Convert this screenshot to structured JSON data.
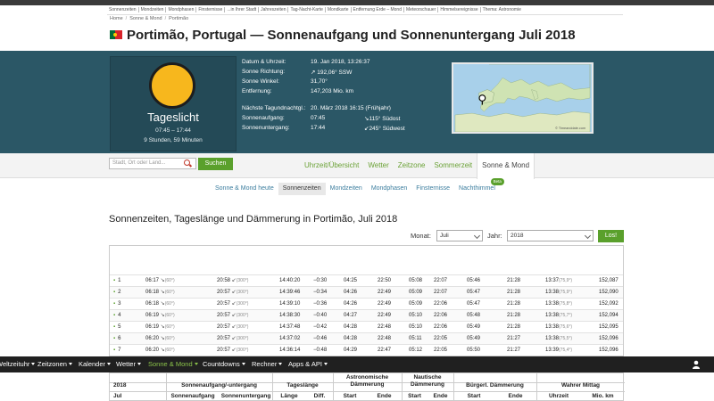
{
  "top_links": [
    "Sonnenzeiten",
    "Mondzeiten",
    "Mondphasen",
    "Finsternisse",
    "...in Ihrer Stadt",
    "Jahreszeiten",
    "Tag-Nacht-Karte",
    "Mondkarte",
    "Entfernung Erde – Mond",
    "Meteorschauer",
    "Himmelsereignisse",
    "Thema: Astronomie"
  ],
  "breadcrumb": {
    "home": "Home",
    "section": "Sonne & Mond",
    "page": "Portimão"
  },
  "title": "Portimão, Portugal — Sonnenaufgang und Sonnenuntergang Juli 2018",
  "daylight": {
    "title": "Tageslicht",
    "times": "07:45 – 17:44",
    "hours": "9 Stunden, 59 Minuten"
  },
  "info": {
    "datetime_label": "Datum & Uhrzeit:",
    "datetime": "19. Jan 2018, 13:26:37",
    "direction_label": "Sonne Richtung:",
    "direction": "↗ 192,06° SSW",
    "angle_label": "Sonne Winkel:",
    "angle": "31,70°",
    "distance_label": "Entfernung:",
    "distance": "147,203 Mio. km",
    "equinox_label": "Nächste Tagundnachtgl.:",
    "equinox": "20. März 2018 16:15 (Frühjahr)",
    "sunrise_label": "Sonnenaufgang:",
    "sunrise": "07:45",
    "sunrise_dir": "↘115° Südost",
    "sunset_label": "Sonnenuntergang:",
    "sunset": "17:44",
    "sunset_dir": "↙245° Südwest"
  },
  "map_credit": "© Timeanddate.com",
  "search": {
    "placeholder": "Stadt, Ort oder Land...",
    "button": "Suchen"
  },
  "tabs": [
    "Uhrzeit/Übersicht",
    "Wetter",
    "Zeitzone",
    "Sommerzeit",
    "Sonne & Mond"
  ],
  "subnav": [
    "Sonne & Mond heute",
    "Sonnenzeiten",
    "Mondzeiten",
    "Mondphasen",
    "Finsternisse",
    "Nachthimmel"
  ],
  "subnav_badge": "Beta",
  "heading": "Sonnenzeiten, Tageslänge und Dämmerung in Portimão, Juli 2018",
  "controls": {
    "month_label": "Monat:",
    "month": "Juli",
    "year_label": "Jahr:",
    "year": "2018",
    "go": "Los!"
  },
  "rows": [
    {
      "day": "1",
      "rise": "06:17",
      "rise_deg": "(60°)",
      "set": "20:58",
      "set_deg": "(300°)",
      "len": "14:40:20",
      "diff": "−0:30",
      "a1": "04:25",
      "a2": "22:50",
      "n1": "05:08",
      "n2": "22:07",
      "b1": "05:46",
      "b2": "21:28",
      "noon": "13:37",
      "noon_deg": "(75,9°)",
      "dist": "152,087"
    },
    {
      "day": "2",
      "rise": "06:18",
      "rise_deg": "(60°)",
      "set": "20:57",
      "set_deg": "(300°)",
      "len": "14:39:46",
      "diff": "−0:34",
      "a1": "04:26",
      "a2": "22:49",
      "n1": "05:09",
      "n2": "22:07",
      "b1": "05:47",
      "b2": "21:28",
      "noon": "13:38",
      "noon_deg": "(75,9°)",
      "dist": "152,090"
    },
    {
      "day": "3",
      "rise": "06:18",
      "rise_deg": "(60°)",
      "set": "20:57",
      "set_deg": "(300°)",
      "len": "14:39:10",
      "diff": "−0:36",
      "a1": "04:26",
      "a2": "22:49",
      "n1": "05:09",
      "n2": "22:06",
      "b1": "05:47",
      "b2": "21:28",
      "noon": "13:38",
      "noon_deg": "(75,8°)",
      "dist": "152,092"
    },
    {
      "day": "4",
      "rise": "06:19",
      "rise_deg": "(60°)",
      "set": "20:57",
      "set_deg": "(300°)",
      "len": "14:38:30",
      "diff": "−0:40",
      "a1": "04:27",
      "a2": "22:49",
      "n1": "05:10",
      "n2": "22:06",
      "b1": "05:48",
      "b2": "21:28",
      "noon": "13:38",
      "noon_deg": "(75,7°)",
      "dist": "152,094"
    },
    {
      "day": "5",
      "rise": "06:19",
      "rise_deg": "(60°)",
      "set": "20:57",
      "set_deg": "(300°)",
      "len": "14:37:48",
      "diff": "−0:42",
      "a1": "04:28",
      "a2": "22:48",
      "n1": "05:10",
      "n2": "22:06",
      "b1": "05:49",
      "b2": "21:28",
      "noon": "13:38",
      "noon_deg": "(75,6°)",
      "dist": "152,095"
    },
    {
      "day": "6",
      "rise": "06:20",
      "rise_deg": "(60°)",
      "set": "20:57",
      "set_deg": "(300°)",
      "len": "14:37:02",
      "diff": "−0:46",
      "a1": "04:28",
      "a2": "22:48",
      "n1": "05:11",
      "n2": "22:05",
      "b1": "05:49",
      "b2": "21:27",
      "noon": "13:38",
      "noon_deg": "(75,5°)",
      "dist": "152,096"
    },
    {
      "day": "7",
      "rise": "06:20",
      "rise_deg": "(60°)",
      "set": "20:57",
      "set_deg": "(300°)",
      "len": "14:36:14",
      "diff": "−0:48",
      "a1": "04:29",
      "a2": "22:47",
      "n1": "05:12",
      "n2": "22:05",
      "b1": "05:50",
      "b2": "21:27",
      "noon": "13:39",
      "noon_deg": "(75,4°)",
      "dist": "152,096"
    }
  ],
  "bottom_nav": [
    {
      "label": "Weltzeituhr",
      "caret": true
    },
    {
      "label": "Zeitzonen",
      "caret": true
    },
    {
      "label": "Kalender",
      "caret": true
    },
    {
      "label": "Wetter",
      "caret": true
    },
    {
      "label": "Sonne & Mond",
      "caret": true,
      "active": true
    },
    {
      "label": "Countdowns",
      "caret": true
    },
    {
      "label": "Rechner",
      "caret": true
    },
    {
      "label": "Apps & API",
      "caret": true
    }
  ],
  "table_header": {
    "year": "2018",
    "month": "Jul",
    "g_sun": "Sonnenaufgang/-untergang",
    "g_len": "Tageslänge",
    "g_astro": "Astronomische Dämmerung",
    "g_naut": "Nautische Dämmerung",
    "g_civil": "Bürgerl. Dämmerung",
    "g_noon": "Wahrer Mittag",
    "c_rise": "Sonnenaufgang",
    "c_set": "Sonnenuntergang",
    "c_len": "Länge",
    "c_diff": "Diff.",
    "c_start": "Start",
    "c_end": "Ende",
    "c_time": "Uhrzeit",
    "c_dist": "Mio. km"
  },
  "colors": {
    "hero": "#2b5766",
    "accent": "#5aa02c",
    "sun": "#f7b71d"
  }
}
